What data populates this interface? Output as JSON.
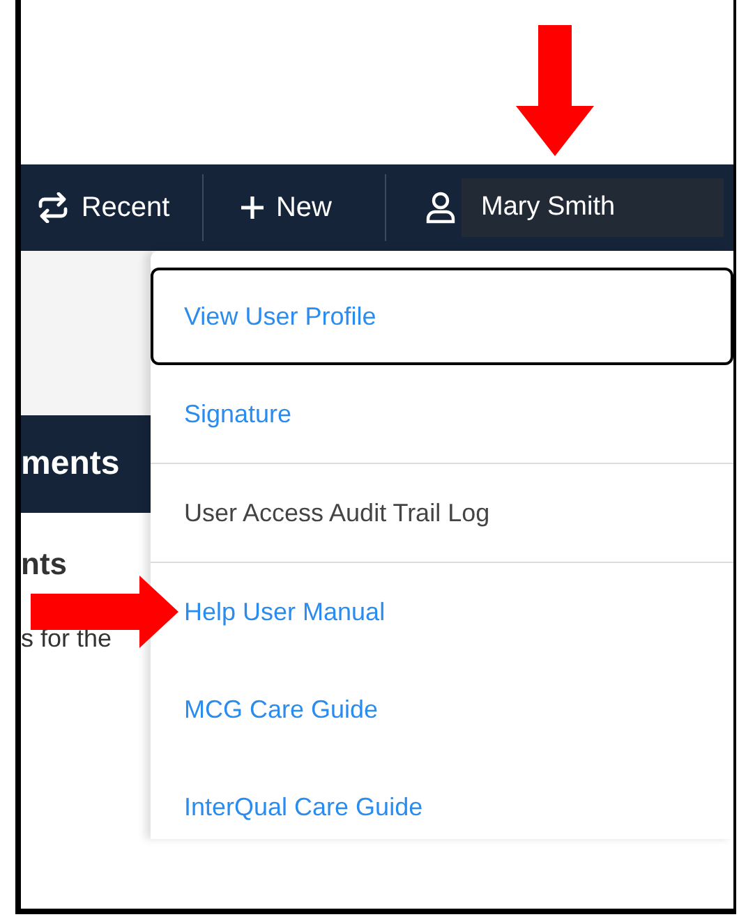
{
  "navbar": {
    "items": [
      {
        "kind": "recent",
        "label": "Recent"
      },
      {
        "kind": "new",
        "label": "New"
      }
    ],
    "user": {
      "name": "Mary Smith"
    }
  },
  "page": {
    "banner": "ments",
    "heading": "nts",
    "text": "s for the"
  },
  "user_menu": {
    "items": [
      {
        "label": "View User Profile",
        "selected": true,
        "disabled": false,
        "separator_after": false
      },
      {
        "label": "Signature",
        "selected": false,
        "disabled": false,
        "separator_after": true
      },
      {
        "label": "User Access Audit Trail Log",
        "selected": false,
        "disabled": true,
        "separator_after": true
      },
      {
        "label": "Help User Manual",
        "selected": false,
        "disabled": false,
        "separator_after": false
      },
      {
        "label": "MCG Care Guide",
        "selected": false,
        "disabled": false,
        "separator_after": false
      },
      {
        "label": "InterQual Care Guide",
        "selected": false,
        "disabled": false,
        "separator_after": false
      }
    ]
  }
}
